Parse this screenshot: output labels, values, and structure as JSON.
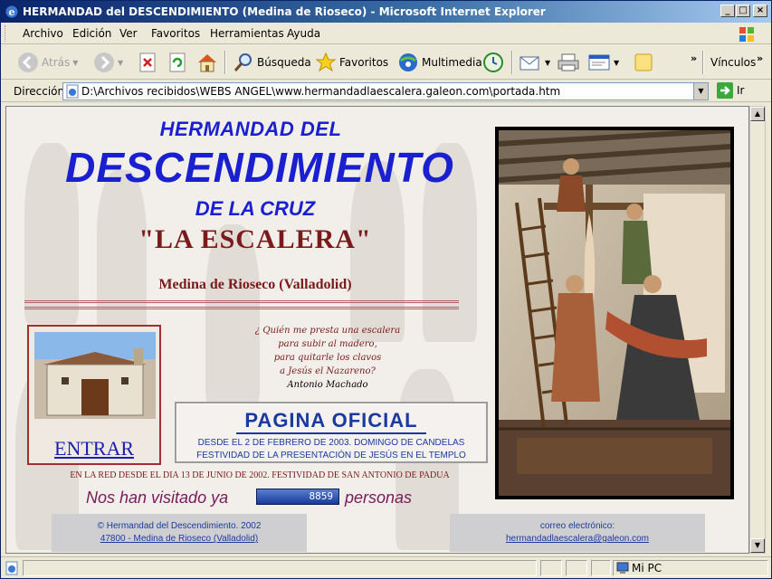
{
  "window": {
    "title": "HERMANDAD del DESCENDIMIENTO (Medina de Rioseco) - Microsoft Internet Explorer"
  },
  "menu": [
    "Archivo",
    "Edición",
    "Ver",
    "Favoritos",
    "Herramientas",
    "Ayuda"
  ],
  "toolbar": {
    "back": "Atrás",
    "search": "Búsqueda",
    "favorites": "Favoritos",
    "media": "Multimedia",
    "links": "Vínculos"
  },
  "address": {
    "label": "Dirección",
    "url": "D:\\Archivos recibidos\\WEBS ANGEL\\www.hermandadlaescalera.galeon.com\\portada.htm",
    "go": "Ir"
  },
  "page": {
    "heading1": "HERMANDAD DEL",
    "heading2": "DESCENDIMIENTO",
    "heading3": "DE LA CRUZ",
    "heading4": "\"LA ESCALERA\"",
    "location": "Medina de Rioseco (Valladolid)",
    "enter": "ENTRAR",
    "poem": [
      "¿ Quién me presta una escalera",
      "para subir al madero,",
      "para quitarle los clavos",
      "a Jesús el Nazareno?"
    ],
    "poem_author": "Antonio Machado",
    "official_title": "PAGINA OFICIAL",
    "official_line1": "DESDE EL 2 DE FEBRERO DE 2003. DOMINGO DE CANDELAS",
    "official_line2": "FESTIVIDAD DE LA PRESENTACIÓN DE JESÚS EN EL TEMPLO",
    "online_since": "EN LA RED DESDE EL DIA 13 DE JUNIO DE 2002. FESTIVIDAD DE SAN ANTONIO DE PADUA",
    "visits_pre": "Nos han visitado ya",
    "visits_count": "8859",
    "visits_post": "personas",
    "footer_left_1": "© Hermandad del Descendimiento. 2002",
    "footer_left_2": "47800 - Medina de Rioseco (Valladolid)",
    "footer_right_1": "correo electrónico:",
    "footer_right_2": "hermandadlaescalera@galeon.com"
  },
  "status": {
    "zone": "Mi PC"
  }
}
